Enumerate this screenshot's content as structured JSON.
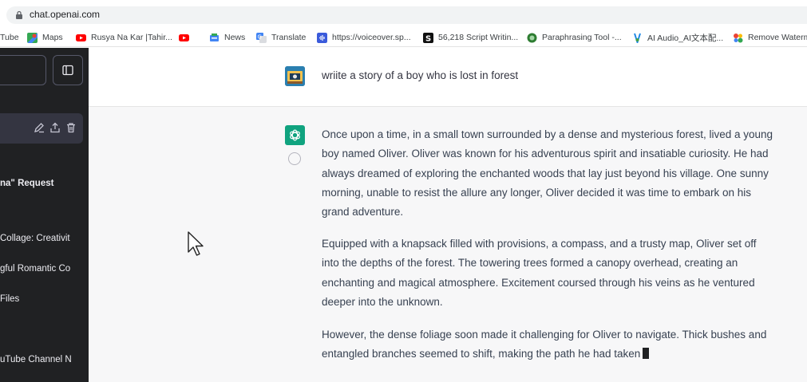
{
  "browser": {
    "url": "chat.openai.com",
    "bookmarks": [
      {
        "label": "Tube",
        "icon": "youtube-icon"
      },
      {
        "label": "Maps",
        "icon": "maps-icon"
      },
      {
        "label": "Rusya Na Kar |Tahir...",
        "icon": "youtube-icon"
      },
      {
        "label": "",
        "icon": "youtube-icon"
      },
      {
        "label": "News",
        "icon": "news-icon"
      },
      {
        "label": "Translate",
        "icon": "translate-icon"
      },
      {
        "label": "https://voiceover.sp...",
        "icon": "voiceover-icon"
      },
      {
        "label": "56,218 Script Writin...",
        "icon": "script-icon"
      },
      {
        "label": "Paraphrasing Tool -...",
        "icon": "paraphrase-icon"
      },
      {
        "label": "AI Audio_AI文本配...",
        "icon": "ai-audio-icon"
      },
      {
        "label": "Remove Waterm",
        "icon": "remove-watermark-icon"
      }
    ]
  },
  "sidebar": {
    "items": [
      {
        "label": "na\" Request"
      },
      {
        "label": "Collage: Creativit"
      },
      {
        "label": "gful Romantic Co"
      },
      {
        "label": "Files"
      },
      {
        "label": "uTube Channel N"
      }
    ]
  },
  "conversation": {
    "user_message": "wriite a story of a boy who is lost in forest",
    "assistant_paragraphs": [
      "Once upon a time, in a small town surrounded by a dense and mysterious forest, lived a young boy named Oliver. Oliver was known for his adventurous spirit and insatiable curiosity. He had always dreamed of exploring the enchanted woods that lay just beyond his village. One sunny morning, unable to resist the allure any longer, Oliver decided it was time to embark on his grand adventure.",
      "Equipped with a knapsack filled with provisions, a compass, and a trusty map, Oliver set off into the depths of the forest. The towering trees formed a canopy overhead, creating an enchanting and magical atmosphere. Excitement coursed through his veins as he ventured deeper into the unknown.",
      "However, the dense foliage soon made it challenging for Oliver to navigate. Thick bushes and entangled branches seemed to shift, making the path he had taken"
    ]
  },
  "colors": {
    "sidebar_bg": "#202123",
    "assistant_bg": "#f7f7f8",
    "accent": "#10a37f"
  }
}
